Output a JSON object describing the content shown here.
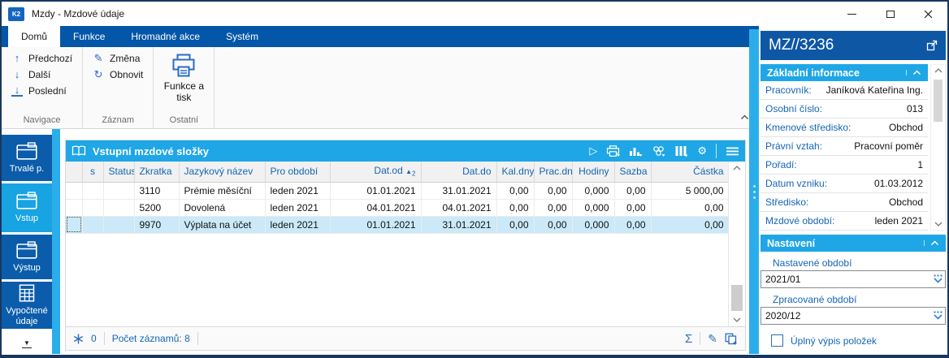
{
  "window": {
    "title": "Mzdy - Mzdové údaje",
    "app_icon_text": "K2"
  },
  "ribbon": {
    "tabs": [
      {
        "label": "Domů"
      },
      {
        "label": "Funkce"
      },
      {
        "label": "Hromadné akce"
      },
      {
        "label": "Systém"
      }
    ],
    "groups": [
      {
        "label": "Navigace",
        "items": [
          {
            "label": "Předchozí",
            "icon": "arrow-up",
            "glyph": "↑"
          },
          {
            "label": "Další",
            "icon": "arrow-down",
            "glyph": "↓"
          },
          {
            "label": "Poslední",
            "icon": "arrow-down-to-bar",
            "glyph": "↓"
          }
        ]
      },
      {
        "label": "Záznam",
        "items": [
          {
            "label": "Změna",
            "icon": "pencil",
            "glyph": "✎"
          },
          {
            "label": "Obnovit",
            "icon": "refresh",
            "glyph": "↻"
          }
        ]
      },
      {
        "label": "Ostatní",
        "big_button": {
          "label": "Funkce a tisk",
          "icon": "printer"
        }
      }
    ]
  },
  "sidebar": {
    "items": [
      {
        "label": "Trvalé p.",
        "icon": "box"
      },
      {
        "label": "Vstup",
        "icon": "box",
        "active": true
      },
      {
        "label": "Výstup",
        "icon": "box"
      },
      {
        "label": "Vypočtené údaje",
        "icon": "calculator"
      }
    ],
    "collapse_glyph": "▼"
  },
  "table": {
    "title": "Vstupní mzdové složky",
    "toolbar": {
      "icons": [
        "play",
        "print",
        "chart",
        "relations",
        "columns",
        "settings",
        "menu"
      ],
      "play_glyph": "▷",
      "gear_glyph": "⚙"
    },
    "columns": [
      "",
      "s",
      "Status",
      "Zkratka",
      "Jazykový název",
      "Pro období",
      "Dat.od",
      "Dat.do",
      "Kal.dny",
      "Prac.dny",
      "Hodiny",
      "Sazba",
      "Částka"
    ],
    "sort": {
      "column": "Dat.od",
      "direction": "asc",
      "glyph": "▲",
      "priority": "2"
    },
    "rows": [
      [
        "",
        "",
        "",
        "3110",
        "Prémie měsíční",
        "leden 2021",
        "01.01.2021",
        "31.01.2021",
        "0,00",
        "0,00",
        "0,000",
        "0,00",
        "5 000,00"
      ],
      [
        "",
        "",
        "",
        "5200",
        "Dovolená",
        "leden 2021",
        "04.01.2021",
        "04.01.2021",
        "0,00",
        "0,00",
        "0,000",
        "0,00",
        "0,00"
      ],
      [
        "",
        "",
        "",
        "9970",
        "Výplata na účet",
        "leden 2021",
        "01.01.2021",
        "31.01.2021",
        "0,00",
        "0,00",
        "0,000",
        "0,00",
        "0,00"
      ]
    ],
    "selected_row_index": 2,
    "status": {
      "flag_count": "0",
      "records_label": "Počet záznamů: 8",
      "sigma_glyph": "Σ",
      "pencil_glyph": "✎"
    }
  },
  "right_panel": {
    "title": "MZ//3236",
    "basic_section": {
      "title": "Základní informace",
      "fields": [
        {
          "label": "Pracovník:",
          "value": "Janíková Kateřina Ing."
        },
        {
          "label": "Osobní číslo:",
          "value": "013"
        },
        {
          "label": "Kmenové středisko:",
          "value": "Obchod"
        },
        {
          "label": "Právní vztah:",
          "value": "Pracovní poměr"
        },
        {
          "label": "Pořadí:",
          "value": "1"
        },
        {
          "label": "Datum vzniku:",
          "value": "01.03.2012"
        },
        {
          "label": "Středisko:",
          "value": "Obchod"
        },
        {
          "label": "Mzdové období:",
          "value": "leden 2021"
        }
      ]
    },
    "settings_section": {
      "title": "Nastavení",
      "period_set": {
        "label": "Nastavené období",
        "value": "2021/01"
      },
      "period_processed": {
        "label": "Zpracované období",
        "value": "2020/12"
      },
      "checkbox": {
        "label": "Úplný výpis položek",
        "checked": false
      }
    }
  },
  "colors": {
    "accent_light_blue": "#1ea6e6",
    "ribbon_blue": "#0456a8",
    "panel_header_blue": "#0e57a5",
    "sidebar_blue": "#0b5dab",
    "sidebar_active": "#18a3e3",
    "label_blue": "#1565b5",
    "selected_row": "#cbe9f8"
  }
}
